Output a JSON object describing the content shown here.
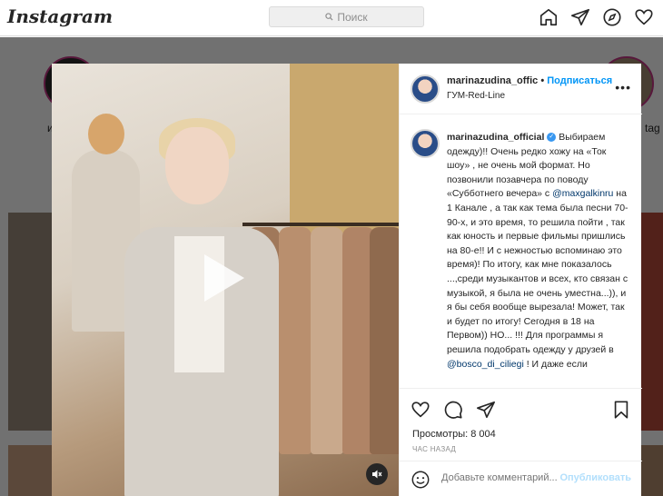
{
  "nav": {
    "logo": "Instagram",
    "search_placeholder": "Поиск",
    "icons": [
      "home-icon",
      "direct-icon",
      "explore-icon",
      "activity-heart-icon"
    ]
  },
  "feed": {
    "story_labels": [
      "и",
      "tag"
    ]
  },
  "post": {
    "header": {
      "username": "marinazudina_offic",
      "dot": "•",
      "follow_label": "Подписаться",
      "location": "ГУМ-Red-Line",
      "more": "•••"
    },
    "caption": {
      "username": "marinazudina_official",
      "text_part1": " Выбираем одежду)!! Очень редко хожу на «Ток шоу» , не очень мой формат. Но позвонили позавчера по поводу «Субботнего вечера» с ",
      "mention1": "@maxgalkinru",
      "text_part2": " на 1 Канале , а так как тема была песни 70-90-х, и это время, то решила пойти , так как юность и первые фильмы пришлись на 80-е!! И с нежностью вспоминаю это время)! По итогу, как мне показалось ...,среди музыкантов и всех, кто связан с музыкой, я была не очень уместна...)), и я бы себя вообще вырезала! Может, так и будет по итогу! Сегодня в 18 на Первом)) НО... !!! Для программы я решила подобрать одежду у друзей в ",
      "mention2": "@bosco_di_ciliegi",
      "text_part3": " ! И даже если"
    },
    "actions": {
      "icons": [
        "heart-icon",
        "comment-icon",
        "share-icon",
        "bookmark-icon"
      ],
      "views": "Просмотры: 8 004",
      "time": "ЧАС НАЗАД"
    },
    "comment": {
      "placeholder": "Добавьте комментарий...",
      "post_label": "Опубликовать"
    }
  }
}
